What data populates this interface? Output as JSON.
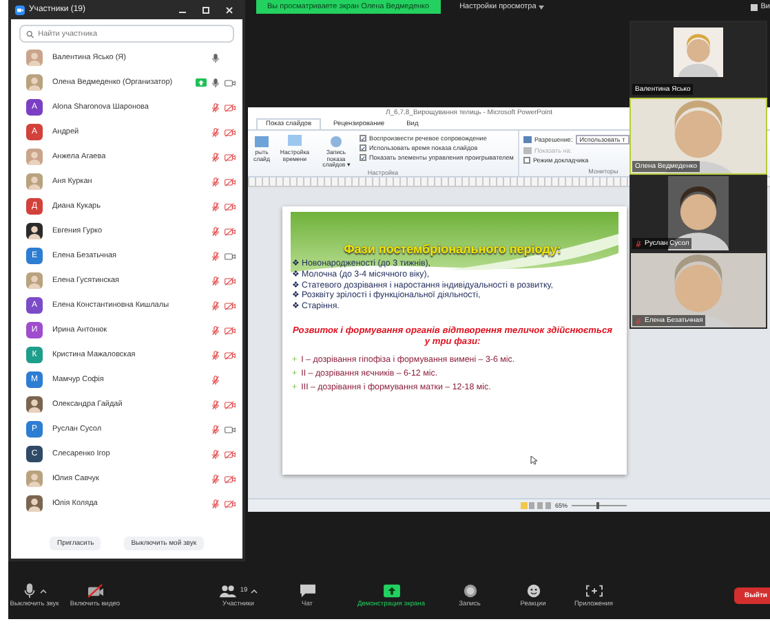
{
  "top_bar": {
    "banner": "Вы просматриваете экран Олена Ведмеденко",
    "view_options": "Настройки просмотра",
    "view_button": "Ви"
  },
  "participants_panel": {
    "title": "Участники (19)",
    "search": {
      "placeholder": "Найти участника"
    },
    "participants": [
      {
        "name": "Валентина Яськo (Я)",
        "sharing": false,
        "mic_muted": false
      },
      {
        "name": "Олена Ведмеденко (Организатор)",
        "sharing": true,
        "mic_muted": false,
        "video": {
          "off": false
        }
      },
      {
        "name": "Alona Sharonova Шаронова",
        "avatar": {
          "kind": "letter",
          "letter": "A",
          "color": "#7b3fc4"
        },
        "sharing": false,
        "mic_muted": true,
        "video": {
          "off": true
        }
      },
      {
        "name": "Андрей",
        "avatar": {
          "kind": "letter",
          "letter": "A",
          "color": "#d2413a"
        },
        "sharing": false,
        "mic_muted": true,
        "video": {
          "off": true
        }
      },
      {
        "name": "Анжела Агаева",
        "sharing": false,
        "mic_muted": true,
        "video": {
          "off": true
        }
      },
      {
        "name": "Аня Куркан",
        "sharing": false,
        "mic_muted": true,
        "video": {
          "off": true
        }
      },
      {
        "name": "Диана Кукарь",
        "avatar": {
          "kind": "letter",
          "letter": "Д",
          "color": "#d2413a"
        },
        "sharing": false,
        "mic_muted": true,
        "video": {
          "off": true
        }
      },
      {
        "name": "Евгения Гурко",
        "sharing": false,
        "mic_muted": true,
        "video": {
          "off": true
        }
      },
      {
        "name": "Елена Безатьчная",
        "avatar": {
          "kind": "letter",
          "letter": "Е",
          "color": "#2d7dd2"
        },
        "sharing": false,
        "mic_muted": true,
        "video": {
          "off": false
        }
      },
      {
        "name": "Елена Гусятинская",
        "sharing": false,
        "mic_muted": true,
        "video": {
          "off": true
        }
      },
      {
        "name": "Елена Константиновна Кишлалы",
        "avatar": {
          "kind": "letter",
          "letter": "А",
          "color": "#7b4bc8"
        },
        "sharing": false,
        "mic_muted": true,
        "video": {
          "off": true
        }
      },
      {
        "name": "Ирина Антонюк",
        "avatar": {
          "kind": "letter",
          "letter": "И",
          "color": "#a04ccf"
        },
        "sharing": false,
        "mic_muted": true,
        "video": {
          "off": true
        }
      },
      {
        "name": "Кристина Мажаловская",
        "avatar": {
          "kind": "letter",
          "letter": "К",
          "color": "#1d9e8a"
        },
        "sharing": false,
        "mic_muted": true,
        "video": {
          "off": true
        }
      },
      {
        "name": "Мамчур Софія",
        "avatar": {
          "kind": "letter",
          "letter": "М",
          "color": "#2d7dd2"
        },
        "sharing": false,
        "mic_muted": true
      },
      {
        "name": "Олександра Гайдай",
        "sharing": false,
        "mic_muted": true,
        "video": {
          "off": true
        }
      },
      {
        "name": "Руслан Сусол",
        "avatar": {
          "kind": "letter",
          "letter": "Р",
          "color": "#2d7dd2"
        },
        "sharing": false,
        "mic_muted": true,
        "video": {
          "off": false
        }
      },
      {
        "name": "Слесаренко Ігор",
        "avatar": {
          "kind": "letter",
          "letter": "С",
          "color": "#2f4a66"
        },
        "sharing": false,
        "mic_muted": true,
        "video": {
          "off": true
        }
      },
      {
        "name": "Юлия Савчук",
        "sharing": false,
        "mic_muted": true,
        "video": {
          "off": true
        }
      },
      {
        "name": "Юлія Коляда",
        "sharing": false,
        "mic_muted": true,
        "video": {
          "off": true
        }
      }
    ],
    "buttons": [
      "Пригласить",
      "Выключить мой звук"
    ]
  },
  "powerpoint": {
    "title": "Л_6,7,8_Вирощування телиць - Microsoft PowerPoint",
    "tabs": [
      {
        "label": "Показ слайдов",
        "selected": true
      },
      {
        "label": "Рецензирование",
        "selected": false
      },
      {
        "label": "Вид",
        "selected": false
      }
    ],
    "ribbon_buttons": [
      "рыть слайд",
      "Настройка времени",
      "Запись показа слайдов ▾"
    ],
    "options": [
      {
        "label": "Воспроизвести речевое сопровождение",
        "checked": true
      },
      {
        "label": "Использовать время показа слайдов",
        "checked": true
      },
      {
        "label": "Показать элементы управления проигрывателем",
        "checked": true
      }
    ],
    "group_setup": "Настройка",
    "resolution_label": "Разрешение:",
    "resolution_value": "Использовать т",
    "show_on": {
      "label": "Показать на:",
      "disabled": true
    },
    "presenter_mode": {
      "label": "Режим докладчика",
      "checked": false
    },
    "group_monitors": "Мониторы",
    "slide": {
      "title": "Фази постембріонального періоду:",
      "bullet_marker": "❖",
      "phase_marker": "+",
      "bullets": [
        "Новонародженості (до 3 тижнів),",
        "Молочна (до 3-4 місячного віку),",
        "Статевого дозрівання і наростання індивідуальності в розвитку,",
        "Розквіту зрілості і функціональної діяльності,",
        "Старіння."
      ],
      "subtitle": "Розвиток і формування органів відтворення теличок здійснюється у три фази:",
      "phases": [
        "I – дозрівання гіпофіза і формування вимені – 3-6 міс.",
        "II – дозрівання яєчників – 6-12 міс.",
        "III – дозрівання і формування матки – 12-18 міс."
      ]
    },
    "zoom": {
      "reading": "65%",
      "level": 0.45
    }
  },
  "video_tiles": [
    {
      "name": "Валентина Яськo",
      "muted": false,
      "active": false,
      "letterboxed": true
    },
    {
      "name": "Олена Ведмеденко",
      "muted": false,
      "active": true,
      "letterboxed": false
    },
    {
      "name": "Руслан Сусол",
      "muted": true,
      "active": false,
      "letterboxed": true
    },
    {
      "name": "Елена Безатьчная",
      "muted": true,
      "active": false,
      "letterboxed": false
    }
  ],
  "toolbar": {
    "items": [
      {
        "kind": "mic",
        "label": "Выключить звук"
      },
      {
        "kind": "video_off",
        "label": "Включить видео"
      },
      {
        "kind": "participants",
        "label": "Участники",
        "count": "19"
      },
      {
        "kind": "chat",
        "label": "Чат"
      },
      {
        "kind": "share",
        "label": "Демонстрация экрана"
      },
      {
        "kind": "record",
        "label": "Запись"
      },
      {
        "kind": "reactions",
        "label": "Реакции"
      },
      {
        "kind": "apps",
        "label": "Приложения"
      }
    ],
    "leave": "Выйти"
  }
}
